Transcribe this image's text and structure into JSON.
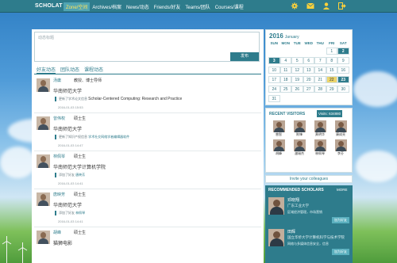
{
  "topbar": {
    "brand": "SCHOLAT",
    "nav": [
      "Zone/空间",
      "Archives/档案",
      "News/动态",
      "Friends/好友",
      "Teams/团队",
      "Courses/课程"
    ]
  },
  "composer": {
    "placeholder": "动态标题",
    "post_label": "发布"
  },
  "tabs": [
    "好友动态",
    "团队动态",
    "课程动态"
  ],
  "feed": [
    {
      "name": "汤庸",
      "title": "教授、博士导师",
      "org": "华南师范大学",
      "action": "更新了学术论文信息",
      "detail": "Scholar-Centered Computing: Research and Practice",
      "date": "2016-01-03 15:53"
    },
    {
      "name": "曾伟权",
      "title": "硕士生",
      "org": "华南师范大学",
      "action": "更新了知识产权信息",
      "detail": "学术社交网络学者编辑器软件",
      "date": "2016-01-03 14:47"
    },
    {
      "name": "林佩琴",
      "title": "硕士生",
      "org": "华南师范大学计算机学院",
      "action": "添加了好友",
      "detail": "唐映芳",
      "date": "2016-01-03 14:41"
    },
    {
      "name": "唐映芳",
      "title": "硕士生",
      "org": "华南师范大学",
      "action": "添加了好友",
      "detail": "林佩琴",
      "date": "2016-01-03 14:41"
    },
    {
      "name": "胡峰",
      "title": "硕士生",
      "org": "猫狮电影",
      "action": "",
      "detail": "",
      "date": ""
    }
  ],
  "calendar": {
    "year": "2016",
    "month": "January",
    "dow": [
      "SUN",
      "MON",
      "TUE",
      "WED",
      "THU",
      "FRI",
      "SAT"
    ],
    "rows": [
      [
        "",
        "",
        "",
        "",
        "",
        "1",
        "2"
      ],
      [
        "3",
        "4",
        "5",
        "6",
        "7",
        "8",
        "9"
      ],
      [
        "10",
        "11",
        "12",
        "13",
        "14",
        "15",
        "16"
      ],
      [
        "17",
        "18",
        "19",
        "20",
        "21",
        "22",
        "23"
      ],
      [
        "24",
        "25",
        "26",
        "27",
        "28",
        "29",
        "30"
      ],
      [
        "31",
        "",
        "",
        "",
        "",
        "",
        ""
      ]
    ],
    "today": "22",
    "marked": [
      "2",
      "3",
      "23"
    ]
  },
  "visitors": {
    "title": "RECENT VISITORS",
    "visits": "Visits: 634880",
    "people": [
      "曾智",
      "陈锋",
      "黄明华",
      "康成亮",
      "胡峰",
      "潘瑞杰",
      "林佩琴",
      "李芬"
    ]
  },
  "invite_label": "Invite your colleagues",
  "recommended": {
    "title": "RECOMMENDED SCHOLARS",
    "more": "MORE",
    "items": [
      {
        "name": "邓晓翔",
        "org": "广东工业大学",
        "desc": "区域经济管理，市场营销",
        "add": "加为好友"
      },
      {
        "name": "田辉",
        "org": "国立华侨大学计算机科学与技术学院",
        "desc": "网络与多媒体信息安全，信息",
        "add": "加为好友"
      }
    ]
  },
  "colors": {
    "accent": "#2e7c8c",
    "highlight": "#ecd56a"
  }
}
